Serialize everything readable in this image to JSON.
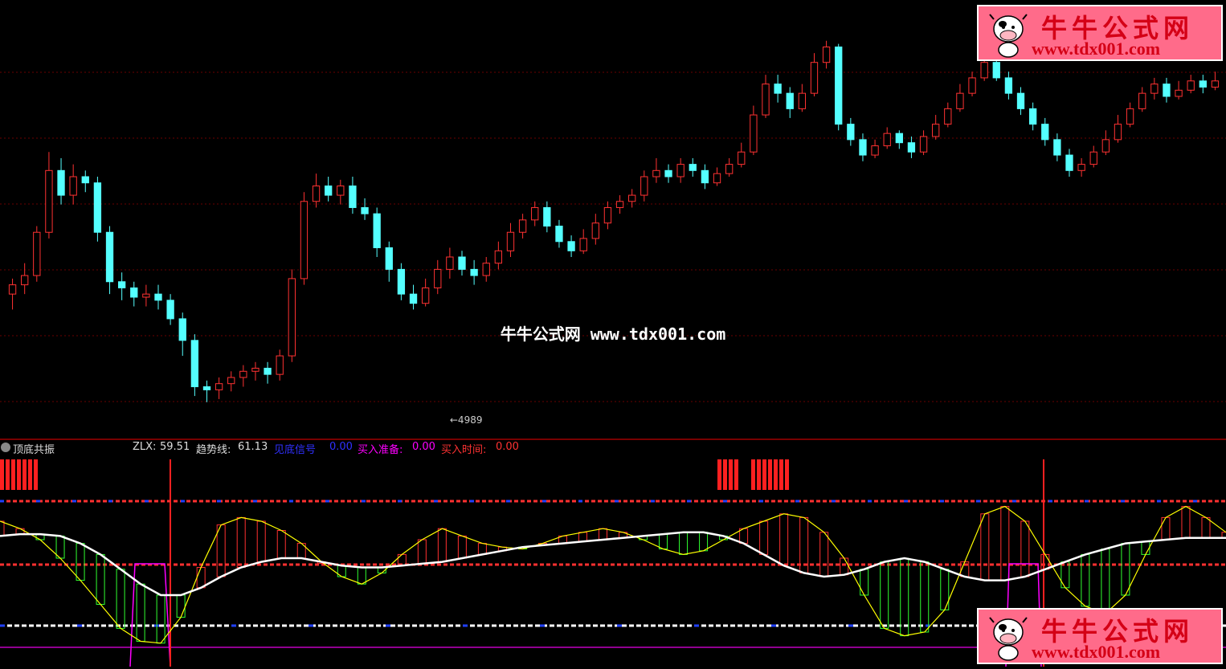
{
  "watermark": {
    "site_name": "牛牛公式网",
    "url": "www.tdx001.com"
  },
  "logo": {
    "title": "牛牛公式网",
    "url": "www.tdx001.com"
  },
  "indicator": {
    "name": "顶底共振",
    "zlx_label": "ZLX:",
    "zlx_value": "59.51",
    "trend_label": "趋势线:",
    "trend_value": "61.13",
    "bottom_signal_label": "见底信号",
    "bottom_signal_value": "0.00",
    "buy_ready_label": "买入准备:",
    "buy_ready_value": "0.00",
    "buy_time_label": "买入时间:",
    "buy_time_value": "0.00"
  },
  "colors": {
    "up": "#ff3232",
    "down": "#54ffff",
    "trend_line": "#ffffff",
    "zlx_line": "#ffff00",
    "bottom_signal": "#0000ff",
    "buy_ready": "#ff00ff",
    "buy_time": "#ff3232"
  },
  "chart_data": [
    {
      "type": "candlestick",
      "title": "",
      "annotations": [
        {
          "text": "←4989",
          "at_bar": 36
        }
      ],
      "ylim": [
        4900,
        6200
      ],
      "candles": [
        [
          5300,
          5330,
          5250,
          5350
        ],
        [
          5330,
          5360,
          5300,
          5400
        ],
        [
          5360,
          5500,
          5340,
          5520
        ],
        [
          5500,
          5700,
          5480,
          5760
        ],
        [
          5700,
          5620,
          5590,
          5740
        ],
        [
          5620,
          5680,
          5590,
          5720
        ],
        [
          5680,
          5660,
          5630,
          5700
        ],
        [
          5660,
          5500,
          5470,
          5680
        ],
        [
          5500,
          5340,
          5300,
          5520
        ],
        [
          5340,
          5320,
          5280,
          5370
        ],
        [
          5320,
          5290,
          5260,
          5340
        ],
        [
          5290,
          5300,
          5260,
          5330
        ],
        [
          5300,
          5280,
          5250,
          5330
        ],
        [
          5280,
          5220,
          5200,
          5300
        ],
        [
          5220,
          5150,
          5100,
          5240
        ],
        [
          5150,
          5000,
          4970,
          5170
        ],
        [
          5000,
          4990,
          4950,
          5020
        ],
        [
          4990,
          5010,
          4960,
          5030
        ],
        [
          5010,
          5030,
          4985,
          5050
        ],
        [
          5030,
          5050,
          5000,
          5070
        ],
        [
          5050,
          5060,
          5020,
          5080
        ],
        [
          5060,
          5040,
          5010,
          5080
        ],
        [
          5040,
          5100,
          5020,
          5120
        ],
        [
          5100,
          5350,
          5080,
          5380
        ],
        [
          5350,
          5600,
          5330,
          5630
        ],
        [
          5600,
          5650,
          5580,
          5690
        ],
        [
          5650,
          5620,
          5600,
          5680
        ],
        [
          5620,
          5650,
          5590,
          5670
        ],
        [
          5650,
          5580,
          5560,
          5680
        ],
        [
          5580,
          5560,
          5540,
          5610
        ],
        [
          5560,
          5450,
          5420,
          5580
        ],
        [
          5450,
          5380,
          5340,
          5470
        ],
        [
          5380,
          5300,
          5280,
          5400
        ],
        [
          5300,
          5270,
          5250,
          5330
        ],
        [
          5270,
          5320,
          5260,
          5350
        ],
        [
          5320,
          5380,
          5300,
          5410
        ],
        [
          5380,
          5420,
          5350,
          5450
        ],
        [
          5420,
          5380,
          5360,
          5440
        ],
        [
          5380,
          5360,
          5330,
          5410
        ],
        [
          5360,
          5400,
          5340,
          5420
        ],
        [
          5400,
          5440,
          5380,
          5470
        ],
        [
          5440,
          5500,
          5420,
          5530
        ],
        [
          5500,
          5540,
          5480,
          5560
        ],
        [
          5540,
          5580,
          5520,
          5600
        ],
        [
          5580,
          5520,
          5500,
          5600
        ],
        [
          5520,
          5470,
          5450,
          5540
        ],
        [
          5470,
          5440,
          5420,
          5490
        ],
        [
          5440,
          5480,
          5430,
          5510
        ],
        [
          5480,
          5530,
          5460,
          5560
        ],
        [
          5530,
          5580,
          5510,
          5600
        ],
        [
          5580,
          5600,
          5560,
          5620
        ],
        [
          5600,
          5620,
          5580,
          5640
        ],
        [
          5620,
          5680,
          5600,
          5700
        ],
        [
          5680,
          5700,
          5660,
          5740
        ],
        [
          5700,
          5680,
          5660,
          5720
        ],
        [
          5680,
          5720,
          5660,
          5740
        ],
        [
          5720,
          5700,
          5680,
          5740
        ],
        [
          5700,
          5660,
          5640,
          5720
        ],
        [
          5660,
          5690,
          5650,
          5710
        ],
        [
          5690,
          5720,
          5680,
          5740
        ],
        [
          5720,
          5760,
          5710,
          5790
        ],
        [
          5760,
          5880,
          5750,
          5910
        ],
        [
          5880,
          5980,
          5870,
          6010
        ],
        [
          5980,
          5950,
          5920,
          6010
        ],
        [
          5950,
          5900,
          5870,
          5970
        ],
        [
          5900,
          5950,
          5890,
          5980
        ],
        [
          5950,
          6050,
          5940,
          6080
        ],
        [
          6050,
          6100,
          6030,
          6120
        ],
        [
          6100,
          5850,
          5830,
          6110
        ],
        [
          5850,
          5800,
          5780,
          5870
        ],
        [
          5800,
          5750,
          5730,
          5820
        ],
        [
          5750,
          5780,
          5740,
          5800
        ],
        [
          5780,
          5820,
          5770,
          5840
        ],
        [
          5820,
          5790,
          5770,
          5830
        ],
        [
          5790,
          5760,
          5740,
          5810
        ],
        [
          5760,
          5810,
          5750,
          5830
        ],
        [
          5810,
          5850,
          5800,
          5880
        ],
        [
          5850,
          5900,
          5840,
          5920
        ],
        [
          5900,
          5950,
          5890,
          5980
        ],
        [
          5950,
          6000,
          5940,
          6020
        ],
        [
          6000,
          6050,
          5990,
          6070
        ],
        [
          6050,
          6000,
          5990,
          6070
        ],
        [
          6000,
          5950,
          5930,
          6020
        ],
        [
          5950,
          5900,
          5880,
          5970
        ],
        [
          5900,
          5850,
          5830,
          5920
        ],
        [
          5850,
          5800,
          5780,
          5870
        ],
        [
          5800,
          5750,
          5730,
          5820
        ],
        [
          5750,
          5700,
          5680,
          5770
        ],
        [
          5700,
          5720,
          5680,
          5740
        ],
        [
          5720,
          5760,
          5710,
          5780
        ],
        [
          5760,
          5800,
          5750,
          5830
        ],
        [
          5800,
          5850,
          5790,
          5880
        ],
        [
          5850,
          5900,
          5840,
          5920
        ],
        [
          5900,
          5950,
          5890,
          5970
        ],
        [
          5950,
          5980,
          5930,
          6000
        ],
        [
          5980,
          5940,
          5920,
          6000
        ],
        [
          5940,
          5960,
          5930,
          5990
        ],
        [
          5960,
          5990,
          5950,
          6010
        ],
        [
          5990,
          5970,
          5950,
          6010
        ],
        [
          5970,
          5990,
          5960,
          6020
        ]
      ]
    },
    {
      "type": "line",
      "title": "",
      "ylim": [
        0,
        100
      ],
      "series": [
        {
          "name": "ZLX",
          "values": [
            70,
            66,
            60,
            50,
            38,
            25,
            12,
            5,
            4,
            18,
            45,
            68,
            72,
            70,
            65,
            58,
            48,
            40,
            36,
            42,
            52,
            60,
            66,
            62,
            58,
            56,
            55,
            58,
            62,
            64,
            66,
            64,
            60,
            55,
            52,
            54,
            60,
            66,
            70,
            74,
            72,
            64,
            50,
            30,
            12,
            8,
            10,
            22,
            48,
            74,
            78,
            70,
            52,
            34,
            24,
            20,
            30,
            52,
            72,
            78,
            72,
            64
          ]
        },
        {
          "name": "趋势线",
          "values": [
            62,
            63,
            63,
            62,
            58,
            52,
            44,
            36,
            30,
            30,
            34,
            40,
            45,
            48,
            50,
            50,
            48,
            46,
            45,
            45,
            46,
            47,
            48,
            50,
            52,
            54,
            56,
            57,
            58,
            59,
            60,
            61,
            62,
            63,
            64,
            64,
            62,
            58,
            52,
            46,
            42,
            40,
            41,
            44,
            48,
            50,
            48,
            44,
            40,
            38,
            38,
            40,
            44,
            48,
            52,
            55,
            58,
            59,
            60,
            61,
            61,
            61
          ]
        }
      ]
    }
  ]
}
